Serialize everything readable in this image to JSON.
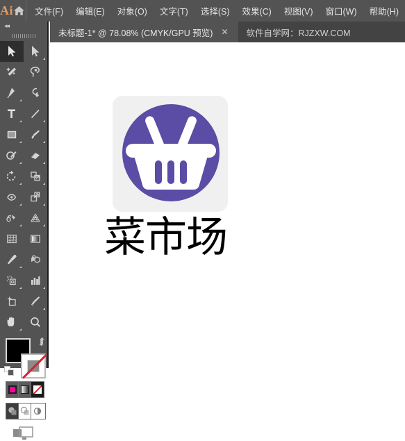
{
  "app": {
    "logo_text": "Ai",
    "home_icon": "home-icon",
    "accent_color": "#E49B62",
    "chrome_color": "#535353",
    "tabbar_color": "#434343"
  },
  "menubar": {
    "items": [
      {
        "label": "文件(F)",
        "name": "menu-file"
      },
      {
        "label": "编辑(E)",
        "name": "menu-edit"
      },
      {
        "label": "对象(O)",
        "name": "menu-object"
      },
      {
        "label": "文字(T)",
        "name": "menu-type"
      },
      {
        "label": "选择(S)",
        "name": "menu-select"
      },
      {
        "label": "效果(C)",
        "name": "menu-effect"
      },
      {
        "label": "视图(V)",
        "name": "menu-view"
      },
      {
        "label": "窗口(W)",
        "name": "menu-window"
      },
      {
        "label": "帮助(H)",
        "name": "menu-help"
      }
    ]
  },
  "tabbar": {
    "tabs": [
      {
        "label": "未标题-1* @ 78.08% (CMYK/GPU 预览)",
        "active": true,
        "closable": true
      },
      {
        "label": "软件自学网：RJZXW.COM",
        "active": false,
        "closable": false
      }
    ],
    "close_glyph": "✕"
  },
  "toolpanel": {
    "collapse_glyph": "◂◂",
    "tools": [
      {
        "name": "selection-tool",
        "label": "选择工具",
        "selected": true,
        "has_flyout": false
      },
      {
        "name": "direct-selection-tool",
        "label": "直接选择工具",
        "selected": false,
        "has_flyout": true
      },
      {
        "name": "magic-wand-tool",
        "label": "魔棒工具",
        "selected": false,
        "has_flyout": false
      },
      {
        "name": "lasso-tool",
        "label": "套索工具",
        "selected": false,
        "has_flyout": false
      },
      {
        "name": "pen-tool",
        "label": "钢笔工具",
        "selected": false,
        "has_flyout": true
      },
      {
        "name": "curvature-tool",
        "label": "曲率工具",
        "selected": false,
        "has_flyout": false
      },
      {
        "name": "type-tool",
        "label": "文字工具",
        "selected": false,
        "has_flyout": true
      },
      {
        "name": "line-segment-tool",
        "label": "直线段工具",
        "selected": false,
        "has_flyout": true
      },
      {
        "name": "rectangle-tool",
        "label": "矩形工具",
        "selected": false,
        "has_flyout": true
      },
      {
        "name": "paintbrush-tool",
        "label": "画笔工具",
        "selected": false,
        "has_flyout": true
      },
      {
        "name": "shaper-tool",
        "label": "Shaper 工具",
        "selected": false,
        "has_flyout": true
      },
      {
        "name": "eraser-tool",
        "label": "橡皮擦工具",
        "selected": false,
        "has_flyout": true
      },
      {
        "name": "rotate-tool",
        "label": "旋转工具",
        "selected": false,
        "has_flyout": true
      },
      {
        "name": "scale-tool",
        "label": "比例缩放工具",
        "selected": false,
        "has_flyout": true
      },
      {
        "name": "width-tool",
        "label": "宽度工具",
        "selected": false,
        "has_flyout": true
      },
      {
        "name": "free-transform-tool",
        "label": "自由变换工具",
        "selected": false,
        "has_flyout": true
      },
      {
        "name": "shape-builder-tool",
        "label": "形状生成器工具",
        "selected": false,
        "has_flyout": true
      },
      {
        "name": "perspective-grid-tool",
        "label": "透视网格工具",
        "selected": false,
        "has_flyout": true
      },
      {
        "name": "mesh-tool",
        "label": "网格工具",
        "selected": false,
        "has_flyout": false
      },
      {
        "name": "gradient-tool",
        "label": "渐变工具",
        "selected": false,
        "has_flyout": false
      },
      {
        "name": "eyedropper-tool",
        "label": "吸管工具",
        "selected": false,
        "has_flyout": true
      },
      {
        "name": "blend-tool",
        "label": "混合工具",
        "selected": false,
        "has_flyout": false
      },
      {
        "name": "symbol-sprayer-tool",
        "label": "符号喷枪工具",
        "selected": false,
        "has_flyout": true
      },
      {
        "name": "column-graph-tool",
        "label": "柱形图工具",
        "selected": false,
        "has_flyout": true
      },
      {
        "name": "artboard-tool",
        "label": "画板工具",
        "selected": false,
        "has_flyout": false
      },
      {
        "name": "slice-tool",
        "label": "切片工具",
        "selected": false,
        "has_flyout": true
      },
      {
        "name": "hand-tool",
        "label": "抓手工具",
        "selected": false,
        "has_flyout": true
      },
      {
        "name": "zoom-tool",
        "label": "缩放工具",
        "selected": false,
        "has_flyout": false
      }
    ],
    "swatches": {
      "fill_color": "#000000",
      "stroke_color": "#FFFFFF",
      "fill_label": "填色",
      "stroke_label": "描边",
      "swap_label": "互换填色和描边",
      "default_label": "默认填色和描边"
    },
    "paint_modes": [
      {
        "name": "color-mode-button",
        "label": "颜色",
        "color": "#FF00A0",
        "active": false
      },
      {
        "name": "gradient-mode-button",
        "label": "渐变",
        "active": false
      },
      {
        "name": "none-mode-button",
        "label": "无",
        "active": false
      }
    ],
    "draw_modes": [
      {
        "name": "draw-normal-button",
        "label": "正常绘图",
        "active": true
      },
      {
        "name": "draw-behind-button",
        "label": "背面绘图",
        "active": false
      },
      {
        "name": "draw-inside-button",
        "label": "内部绘图",
        "active": false
      }
    ],
    "screen_mode": {
      "name": "screen-mode-button",
      "label": "更改屏幕模式"
    }
  },
  "canvas": {
    "background": "#FFFFFF",
    "artwork": {
      "tile_color": "#F0F0F0",
      "circle_color": "#5B4DA5",
      "basket_color": "#FFFFFF",
      "brand_text": "菜市场",
      "brand_color": "#000000"
    }
  }
}
